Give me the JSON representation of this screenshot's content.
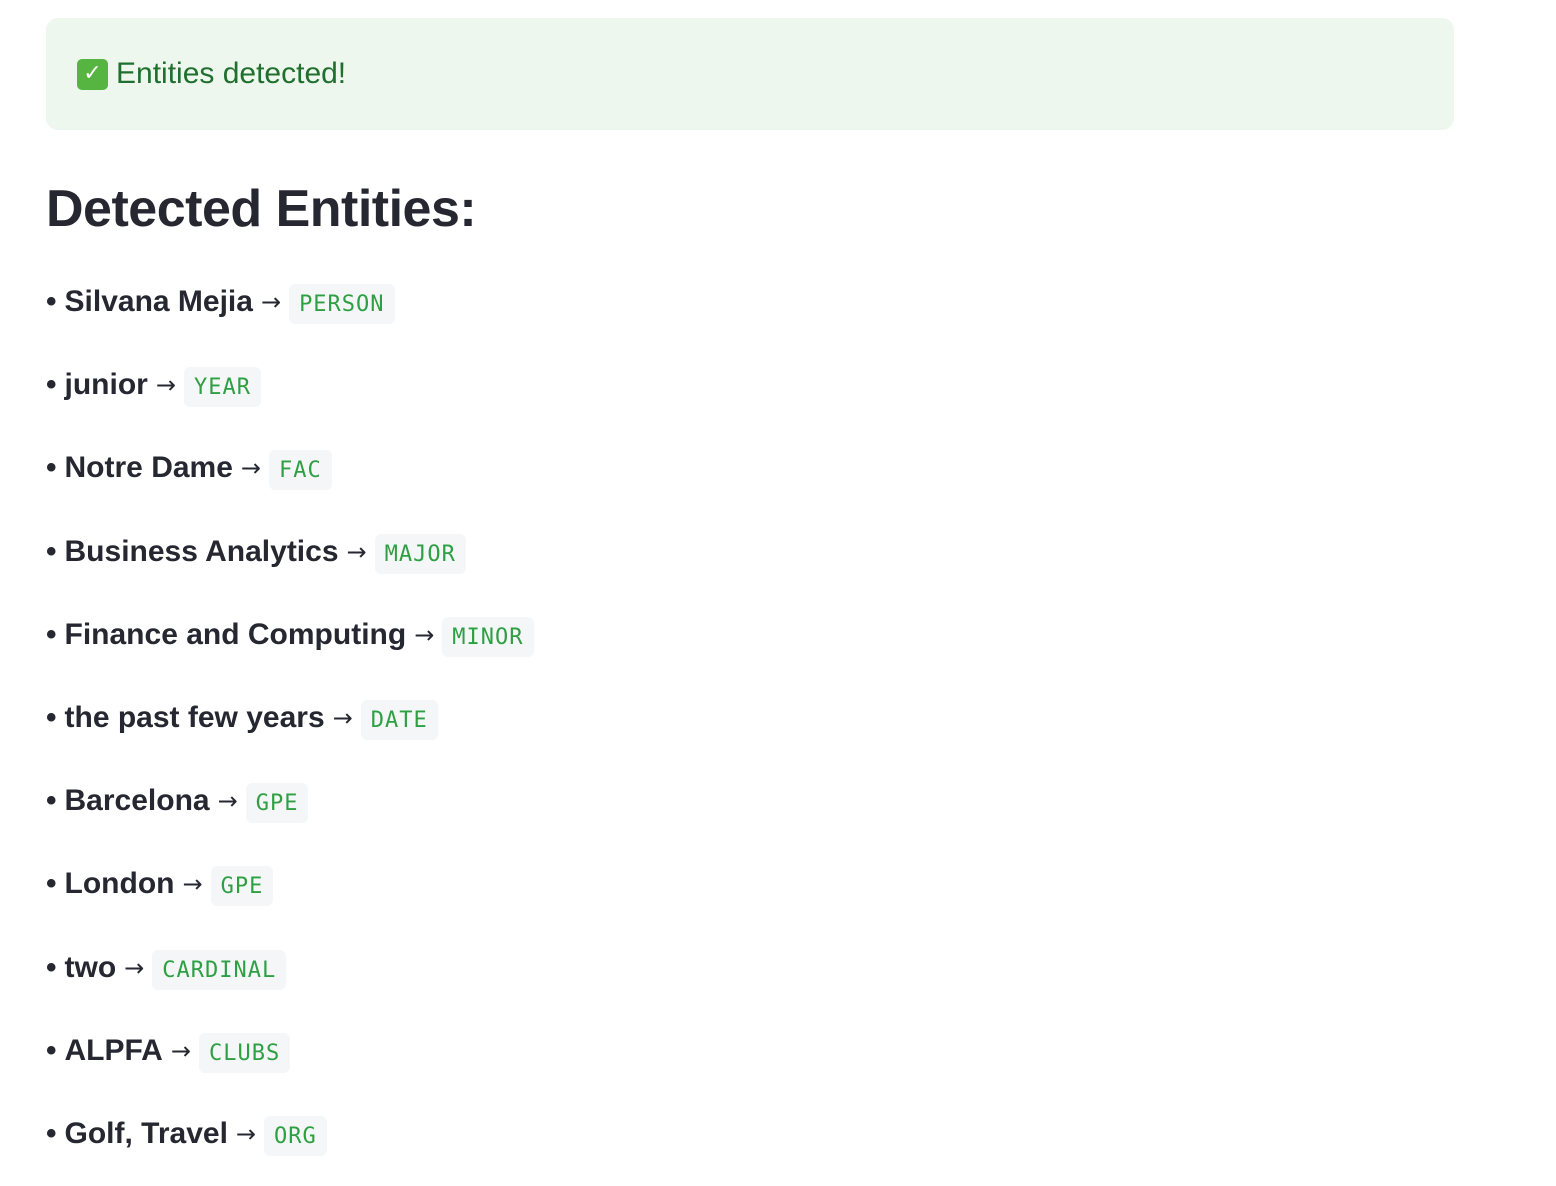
{
  "alert": {
    "icon": "check-mark-emoji",
    "text": "Entities detected!"
  },
  "title": "Detected Entities:",
  "bullet": "•",
  "arrow": "→",
  "entities": [
    {
      "text": "Silvana Mejia",
      "label": "PERSON"
    },
    {
      "text": "junior",
      "label": "YEAR"
    },
    {
      "text": "Notre Dame",
      "label": "FAC"
    },
    {
      "text": "Business Analytics",
      "label": "MAJOR"
    },
    {
      "text": "Finance and Computing",
      "label": "MINOR"
    },
    {
      "text": "the past few years",
      "label": "DATE"
    },
    {
      "text": "Barcelona",
      "label": "GPE"
    },
    {
      "text": "London",
      "label": "GPE"
    },
    {
      "text": "two",
      "label": "CARDINAL"
    },
    {
      "text": "ALPFA",
      "label": "CLUBS"
    },
    {
      "text": "Golf, Travel",
      "label": "ORG"
    }
  ],
  "colors": {
    "alert_bg": "#edf7ee",
    "alert_text": "#1f6f2e",
    "tag_text": "#2ea043",
    "tag_bg": "#f5f6f8",
    "heading": "#262730"
  }
}
